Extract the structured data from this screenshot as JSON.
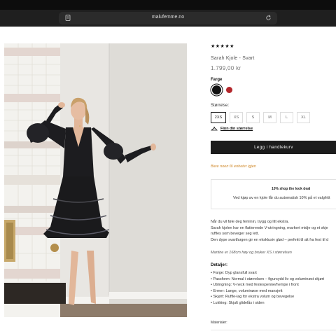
{
  "browser": {
    "url": "malufemme.no",
    "reader_icon": "reader-icon",
    "reload_icon": "reload-icon"
  },
  "product": {
    "rating": "★★★★★",
    "title": "Sarah Kjole - Svart",
    "price": "1.799,00 kr",
    "color_label": "Farge",
    "colors": [
      {
        "name": "black",
        "hex": "#111111",
        "selected": true
      },
      {
        "name": "red",
        "hex": "#b3262b",
        "selected": false
      }
    ],
    "size_label": "Størrelse:",
    "sizes": [
      "2XS",
      "XS",
      "S",
      "M",
      "L",
      "XL"
    ],
    "selected_size": "2XS",
    "size_guide": "Finn din størrelse",
    "add_to_cart": "Legg i handlekurv",
    "low_stock": "Bare noen få enheter igjen"
  },
  "promo": {
    "title": "10% shop the look deal",
    "text": "Ved kjøp av en kjole får du automatisk 10% på et valgfritt"
  },
  "description": {
    "lines": [
      "Når du vil føle deg feminin, trygg og litt ekstra.",
      "Sarah kjolen har en flatterende V-utringning, markert midje og et skje",
      "ruffles som beveger seg lett.",
      "Den dype svartfargen gir en eksklusiv glød – perfekt til alt fra fest til d"
    ],
    "model_note": "Martine er 168cm høy og bruker XS i størrelsen"
  },
  "details": {
    "heading": "Detaljer:",
    "items": [
      "• Farge: Dyp glansfull svart",
      "• Passform: Normal i størrelsen – figursydd liv og voluminøst skjørt",
      "• Utringning: V-neck med festespenne/hempe i front",
      "• Ermer: Lange, voluminøse med mansjett",
      "• Skjørt: Ruffle-lag for ekstra volum og bevegelse",
      "• Lukking: Skjult glidelås i siden"
    ]
  },
  "materials_label": "Materialer:",
  "colors": {
    "accent_orange": "#d08a2c",
    "cart_bg": "#1c1c1c"
  }
}
